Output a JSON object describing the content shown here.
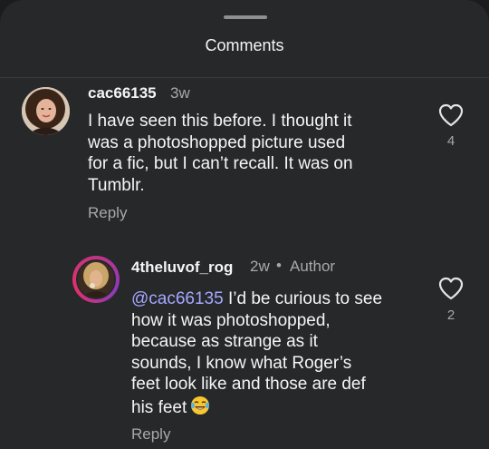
{
  "sheet": {
    "title": "Comments"
  },
  "comments": [
    {
      "username": "cac66135",
      "time": "3w",
      "text": "I have seen this before.  I thought it\nwas a photoshopped picture used\nfor a fic, but I can’t recall.  It was on\nTumblr.",
      "reply_label": "Reply",
      "likes": "4"
    },
    {
      "username": "4theluvof_rog",
      "time": "2w",
      "separator": "•",
      "badge": "Author",
      "mention": "@cac66135",
      "text": " I’d be curious to see\nhow it was photoshopped,\nbecause as strange as it\nsounds, I know what Roger’s\nfeet look like and those are def\nhis feet",
      "emoji": "face-with-tears-of-joy",
      "reply_label": "Reply",
      "likes": "2"
    }
  ],
  "colors": {
    "sheet_bg": "#27282a",
    "text_primary": "#f5f5f5",
    "text_secondary": "#a8a8a8",
    "mention": "#a4a8ff"
  }
}
